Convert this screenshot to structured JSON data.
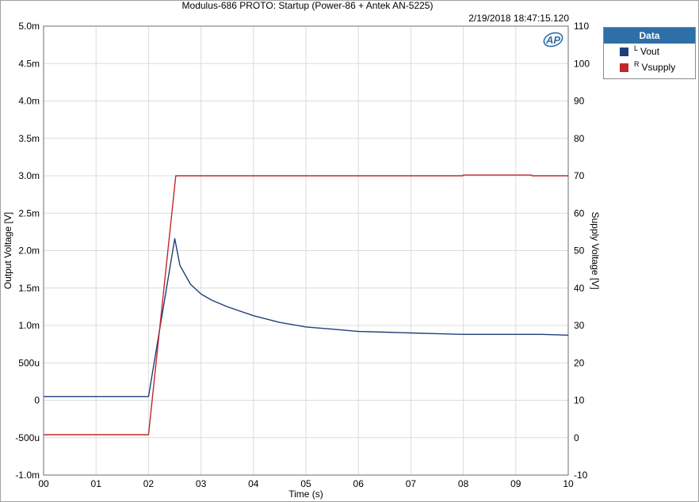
{
  "header": {
    "title": "Modulus-686 PROTO: Startup (Power-86 + Antek AN-5225)",
    "timestamp": "2/19/2018 18:47:15.120"
  },
  "legend": {
    "header": "Data",
    "items": [
      {
        "channel": "L",
        "label": "Vout",
        "color": "#1f3f7a"
      },
      {
        "channel": "R",
        "label": "Vsupply",
        "color": "#c0282b"
      }
    ]
  },
  "logo": {
    "text": "AP",
    "icon": "ap-logo-icon"
  },
  "chart_data": {
    "type": "line",
    "title": "Modulus-686 PROTO: Startup (Power-86 + Antek AN-5225)",
    "xlabel": "Time (s)",
    "ylabel": "Output Voltage [V]",
    "y2label": "Supply Voltage [V]",
    "xlim": [
      0,
      10
    ],
    "ylim": [
      -0.001,
      0.005
    ],
    "y2lim": [
      -10,
      110
    ],
    "grid": true,
    "legend_position": "outside-top-right",
    "x_ticks": [
      {
        "v": 0,
        "label": "00"
      },
      {
        "v": 1,
        "label": "01"
      },
      {
        "v": 2,
        "label": "02"
      },
      {
        "v": 3,
        "label": "03"
      },
      {
        "v": 4,
        "label": "04"
      },
      {
        "v": 5,
        "label": "05"
      },
      {
        "v": 6,
        "label": "06"
      },
      {
        "v": 7,
        "label": "07"
      },
      {
        "v": 8,
        "label": "08"
      },
      {
        "v": 9,
        "label": "09"
      },
      {
        "v": 10,
        "label": "10"
      }
    ],
    "y_ticks": [
      {
        "v": 0.005,
        "label": "5.0m"
      },
      {
        "v": 0.0045,
        "label": "4.5m"
      },
      {
        "v": 0.004,
        "label": "4.0m"
      },
      {
        "v": 0.0035,
        "label": "3.5m"
      },
      {
        "v": 0.003,
        "label": "3.0m"
      },
      {
        "v": 0.0025,
        "label": "2.5m"
      },
      {
        "v": 0.002,
        "label": "2.0m"
      },
      {
        "v": 0.0015,
        "label": "1.5m"
      },
      {
        "v": 0.001,
        "label": "1.0m"
      },
      {
        "v": 0.0005,
        "label": "500u"
      },
      {
        "v": 0,
        "label": "0"
      },
      {
        "v": -0.0005,
        "label": "-500u"
      },
      {
        "v": -0.001,
        "label": "-1.0m"
      }
    ],
    "y2_ticks": [
      {
        "v": 110,
        "label": "110"
      },
      {
        "v": 100,
        "label": "100"
      },
      {
        "v": 90,
        "label": "90"
      },
      {
        "v": 80,
        "label": "80"
      },
      {
        "v": 70,
        "label": "70"
      },
      {
        "v": 60,
        "label": "60"
      },
      {
        "v": 50,
        "label": "50"
      },
      {
        "v": 40,
        "label": "40"
      },
      {
        "v": 30,
        "label": "30"
      },
      {
        "v": 20,
        "label": "20"
      },
      {
        "v": 10,
        "label": "10"
      },
      {
        "v": 0,
        "label": "0"
      },
      {
        "v": -10,
        "label": "-10"
      }
    ],
    "series": [
      {
        "name": "Vout",
        "axis": "left",
        "color": "#1f3f7a",
        "x": [
          0,
          2.0,
          2.5,
          2.6,
          2.8,
          3.0,
          3.2,
          3.5,
          4.0,
          4.5,
          5.0,
          5.5,
          6.0,
          6.5,
          7.0,
          7.5,
          8.0,
          8.5,
          9.0,
          9.5,
          10.0
        ],
        "y": [
          5e-05,
          5e-05,
          0.00216,
          0.0018,
          0.00155,
          0.00142,
          0.00134,
          0.00125,
          0.00113,
          0.00104,
          0.00098,
          0.00095,
          0.00092,
          0.00091,
          0.0009,
          0.00089,
          0.00088,
          0.00088,
          0.00088,
          0.00088,
          0.00087
        ]
      },
      {
        "name": "Vsupply",
        "axis": "right",
        "color": "#c0282b",
        "x": [
          0,
          2.0,
          2.52,
          7.99,
          8.0,
          9.3,
          9.31,
          10.0
        ],
        "y": [
          0.8,
          0.8,
          70,
          70,
          70.2,
          70.2,
          70,
          70
        ]
      }
    ]
  }
}
